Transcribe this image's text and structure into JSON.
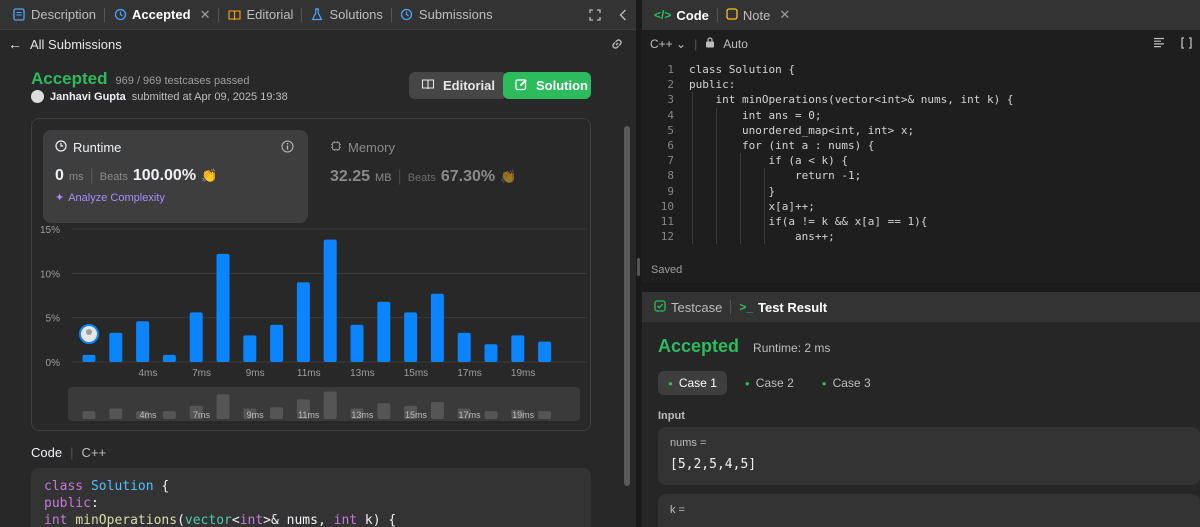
{
  "left_tabs": {
    "description": "Description",
    "accepted": "Accepted",
    "editorial": "Editorial",
    "solutions": "Solutions",
    "submissions": "Submissions"
  },
  "subbar": {
    "back_label": "All Submissions"
  },
  "result": {
    "status": "Accepted",
    "testcases": "969 / 969 testcases passed",
    "user": "Janhavi Gupta",
    "submitted": "submitted at Apr 09, 2025 19:38",
    "editorial_btn": "Editorial",
    "solution_btn": "Solution"
  },
  "runtime": {
    "label": "Runtime",
    "value": "0",
    "unit": "ms",
    "beats_label": "Beats",
    "beats_value": "100.00%",
    "analyze": "Analyze Complexity"
  },
  "memory": {
    "label": "Memory",
    "value": "32.25",
    "unit": "MB",
    "beats_label": "Beats",
    "beats_value": "67.30%"
  },
  "chart_data": {
    "type": "bar",
    "yticks": [
      "15%",
      "10%",
      "5%",
      "0%"
    ],
    "ylim": [
      0,
      15
    ],
    "categories": [
      "1",
      "2",
      "3",
      "4",
      "5",
      "6",
      "7",
      "8",
      "9",
      "10",
      "11",
      "12",
      "13",
      "14",
      "15",
      "16",
      "17",
      "18",
      "19",
      "20",
      "21"
    ],
    "xtick_labels": [
      "4ms",
      "7ms",
      "9ms",
      "11ms",
      "13ms",
      "15ms",
      "17ms",
      "19ms"
    ],
    "values": [
      0.8,
      3.3,
      4.6,
      0.8,
      5.6,
      12.2,
      3.0,
      4.2,
      9.0,
      13.8,
      4.2,
      6.8,
      5.6,
      7.7,
      3.3,
      2.0,
      3.0,
      2.3
    ],
    "highlight_color": "#0a84ff",
    "mini_values": [
      0.3,
      0.5,
      0.3,
      0.3,
      0.7,
      1.6,
      0.5,
      0.6,
      1.2,
      1.8,
      0.5,
      0.9,
      0.7,
      1.0,
      0.5,
      0.3,
      0.4,
      0.3
    ]
  },
  "code_section": {
    "label": "Code",
    "lang": "C++",
    "lines": [
      "class Solution {",
      "public:",
      "    int minOperations(vector<int>& nums, int k) {"
    ]
  },
  "right_tabs": {
    "code": "Code",
    "note": "Note"
  },
  "editor_toolbar": {
    "lang": "C++",
    "mode": "Auto"
  },
  "editor": {
    "lines": [
      "class Solution {",
      "public:",
      "    int minOperations(vector<int>& nums, int k) {",
      "        int ans = 0;",
      "        unordered_map<int, int> x;",
      "        for (int a : nums) {",
      "            if (a < k) {",
      "                return -1;",
      "            }",
      "            x[a]++;",
      "            if(a != k && x[a] == 1){",
      "                ans++;"
    ],
    "line_numbers": [
      "1",
      "2",
      "3",
      "4",
      "5",
      "6",
      "7",
      "8",
      "9",
      "10",
      "11",
      "12"
    ],
    "status": "Saved"
  },
  "testcase_tabs": {
    "testcase": "Testcase",
    "result": "Test Result"
  },
  "test_result": {
    "status": "Accepted",
    "runtime": "Runtime: 2 ms",
    "cases": [
      "Case 1",
      "Case 2",
      "Case 3"
    ],
    "input_label": "Input",
    "nums_label": "nums =",
    "nums_value": "[5,2,5,4,5]",
    "k_label": "k ="
  }
}
